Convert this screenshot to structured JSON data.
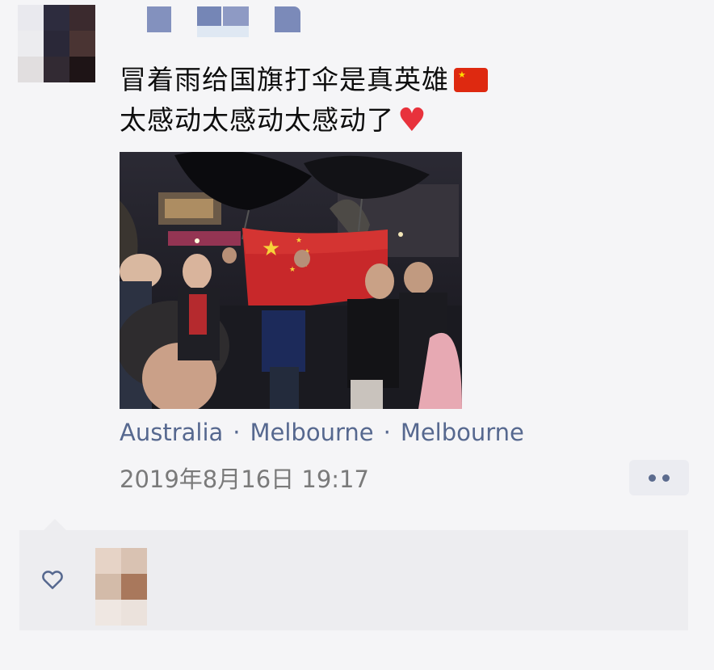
{
  "post": {
    "caption_line1": "冒着雨给国旗打伞是真英雄",
    "caption_line2": "太感动太感动太感动了",
    "caption_line1_emoji": "china-flag-emoji",
    "caption_line2_emoji": "red-heart-emoji",
    "location": [
      "Australia",
      "Melbourne",
      "Melbourne"
    ],
    "location_separator": "·",
    "timestamp": "2019年8月16日 19:17"
  },
  "colors": {
    "link": "#56688f",
    "timestamp": "#7a7a7a",
    "panel": "#ededf0",
    "flag_red": "#de2910",
    "flag_star": "#ffde00",
    "heart": "#e8323c"
  },
  "icons": {
    "more": "more-dots-icon",
    "like": "heart-outline-icon"
  }
}
